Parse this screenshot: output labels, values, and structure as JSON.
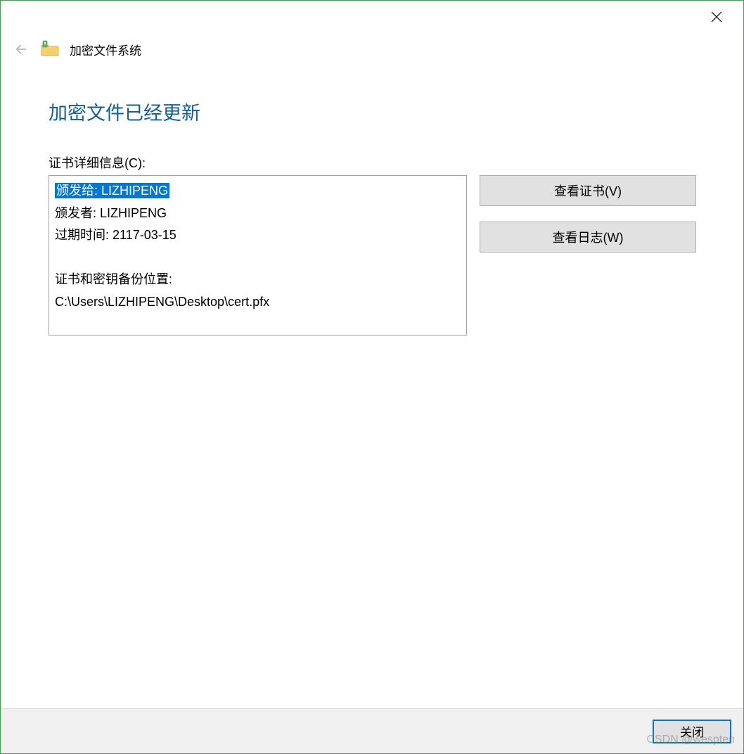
{
  "header": {
    "title": "加密文件系统"
  },
  "page": {
    "heading": "加密文件已经更新",
    "details_label": "证书详细信息(C):"
  },
  "cert": {
    "issued_to": "颁发给: LIZHIPENG",
    "issued_by": "颁发者: LIZHIPENG",
    "expires": "过期时间: 2117-03-15",
    "backup_label": "证书和密钥备份位置:",
    "backup_path": "C:\\Users\\LIZHIPENG\\Desktop\\cert.pfx"
  },
  "buttons": {
    "view_cert": "查看证书(V)",
    "view_log": "查看日志(W)",
    "close": "关闭"
  },
  "watermark": "CSDN @wespten"
}
